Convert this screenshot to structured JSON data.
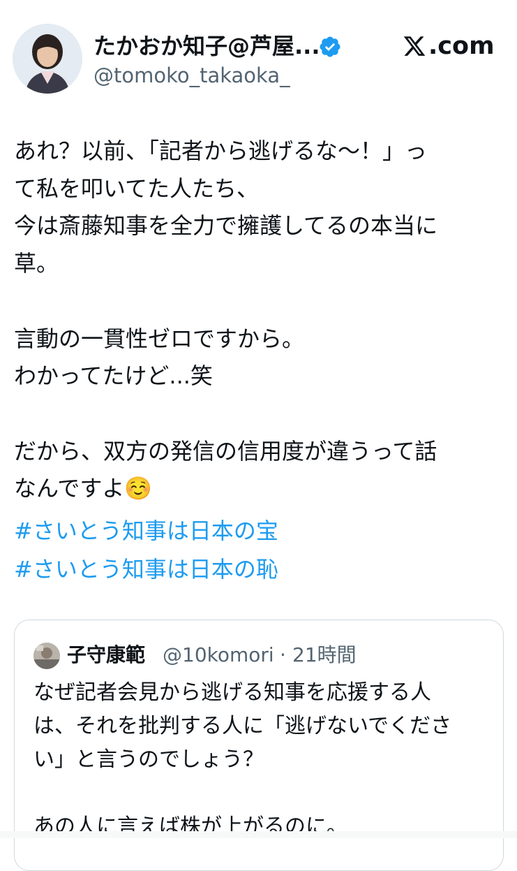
{
  "author": {
    "display_name": "たかおか知子@芦屋...",
    "handle": "@tomoko_takaoka_",
    "verified": true,
    "avatar_icon": "profile-photo-woman"
  },
  "brand": {
    "label": ".com",
    "logo_icon": "x-logo-icon"
  },
  "tweet": {
    "text": "あれ？以前、「記者から逃げるな〜！」っ\nて私を叩いてた人たち、\n今は斎藤知事を全力で擁護してるの本当に\n草。\n\n言動の一貫性ゼロですから。\nわかってたけど...笑\n\nだから、双方の発信の信用度が違うって話\nなんですよ☺️",
    "hashtags": [
      "#さいとう知事は日本の宝",
      "#さいとう知事は日本の恥"
    ]
  },
  "quoted": {
    "display_name": "子守康範",
    "handle": "@10komori",
    "separator": "·",
    "time": "21時間",
    "text": "なぜ記者会見から逃げる知事を応援する人\nは、それを批判する人に「逃げないでくださ\nい」と言うのでしょう？\n\nあの人に言えば株が上がるのに。"
  },
  "colors": {
    "text": "#0f1419",
    "secondary": "#536471",
    "link": "#1d9bf0",
    "verified": "#1d9bf0",
    "border": "#cfd9de"
  }
}
